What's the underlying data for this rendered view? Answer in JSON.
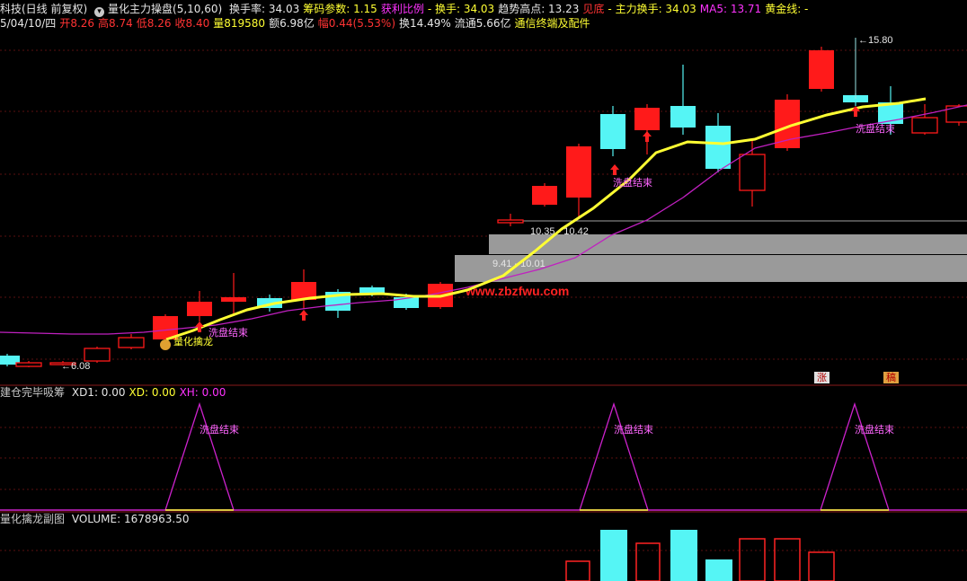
{
  "header": {
    "title": "科技(日线 前复权)",
    "indicator_icon": "collapse-icon",
    "indicator": "量化主力操盘(5,10,60)",
    "fields1": [
      {
        "label": "换手率: 34.03",
        "color": "#e6e6e6"
      },
      {
        "label": "筹码参数: 1.15",
        "color": "#ffff33"
      },
      {
        "label": "获利比例",
        "color": "#ff33ff"
      },
      {
        "label": "- 换手: 34.03",
        "color": "#ffff33"
      },
      {
        "label": "趋势高点: 13.23",
        "color": "#e6e6e6"
      },
      {
        "label": "见底",
        "color": "#ff3333"
      },
      {
        "label": "- 主力换手: 34.03",
        "color": "#ffff33"
      },
      {
        "label": "MA5: 13.71",
        "color": "#ff33ff"
      },
      {
        "label": "黄金线: -",
        "color": "#ffff33"
      }
    ],
    "fields2": [
      {
        "label": "5/04/10/四",
        "color": "#e6e6e6"
      },
      {
        "label": "开8.26",
        "color": "#ff3333"
      },
      {
        "label": "高8.74",
        "color": "#ff3333"
      },
      {
        "label": "低8.26",
        "color": "#ff3333"
      },
      {
        "label": "收8.40",
        "color": "#ff3333"
      },
      {
        "label": "量819580",
        "color": "#ffff33"
      },
      {
        "label": "额6.98亿",
        "color": "#e6e6e6"
      },
      {
        "label": "幅0.44(5.53%)",
        "color": "#ff3333"
      },
      {
        "label": "换14.49%",
        "color": "#e6e6e6"
      },
      {
        "label": "流通5.66亿",
        "color": "#e6e6e6"
      },
      {
        "label": "通信终端及配件",
        "color": "#ffff33"
      }
    ]
  },
  "main_chart": {
    "high_marker": "15.80",
    "low_marker": "6.08",
    "zone_labels": [
      "10.35 - 10.42",
      "9.41 - 10.01"
    ],
    "watermark": "www.zbzfwu.com",
    "signal_labels": [
      "洗盘结束",
      "洗盘结束",
      "洗盘结束"
    ],
    "start_label": "量化擒龙",
    "badges": [
      "涨",
      "稿"
    ],
    "colors": {
      "up": "#ff1a1a",
      "down": "#55f5f5",
      "ma_fast": "#ffff33",
      "ma_slow": "#c020c0"
    }
  },
  "panel2": {
    "title": "建仓完毕吸筹",
    "fields": [
      {
        "label": "XD1: 0.00",
        "color": "#e6e6e6"
      },
      {
        "label": "XD: 0.00",
        "color": "#ffff33"
      },
      {
        "label": "XH: 0.00",
        "color": "#ff33ff"
      }
    ],
    "peak_labels": [
      "洗盘结束",
      "洗盘结束",
      "洗盘结束"
    ]
  },
  "panel3": {
    "title": "量化擒龙副图",
    "volume_label": "VOLUME: 1678963.50"
  }
}
